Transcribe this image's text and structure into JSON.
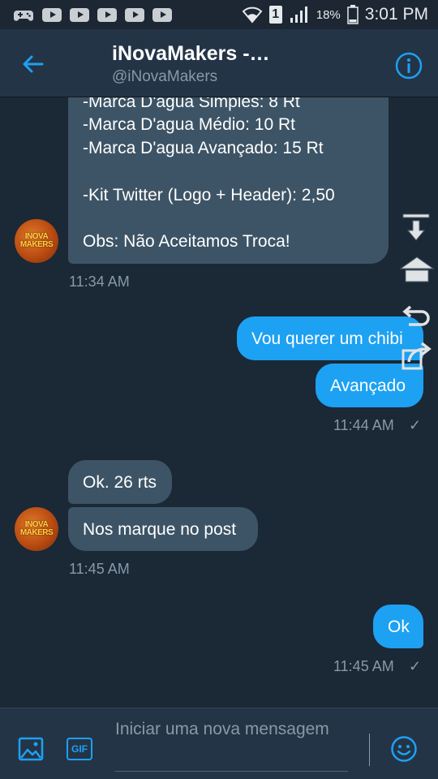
{
  "status_bar": {
    "battery": "18%",
    "time": "3:01 PM",
    "sim": "1",
    "icons": [
      "game-controller-icon",
      "youtube-icon",
      "youtube-icon",
      "youtube-icon",
      "youtube-icon",
      "youtube-icon",
      "wifi-icon",
      "sim-icon",
      "signal-icon",
      "battery-icon"
    ]
  },
  "header": {
    "title": "iNovaMakers -…",
    "handle": "@iNovaMakers"
  },
  "messages": {
    "price_lines": [
      "-Marca D'agua Simples: 8 Rt",
      "-Marca D'agua Médio: 10 Rt",
      "-Marca D'agua Avançado: 15 Rt",
      "-Kit Twitter (Logo + Header): 2,50",
      "Obs: Não Aceitamos Troca!"
    ],
    "time_1": "11:34 AM",
    "out_1": "Vou querer um chibi",
    "out_2": "Avançado",
    "time_2": "11:44 AM",
    "in_1": "Ok. 26 rts",
    "in_2": "Nos marque no post",
    "time_3": "11:45 AM",
    "out_3": "Ok",
    "time_4": "11:45 AM",
    "read_mark": "✓"
  },
  "avatar": {
    "logo_text": "INOVA MAKERS"
  },
  "composer": {
    "placeholder": "Iniciar uma nova mensagem",
    "gif_label": "GIF"
  },
  "colors": {
    "background": "#1b2836",
    "header": "#243447",
    "incoming_bubble": "#3d5466",
    "outgoing_bubble": "#1da1f2",
    "accent": "#1da1f2",
    "secondary_text": "#8899a6"
  }
}
